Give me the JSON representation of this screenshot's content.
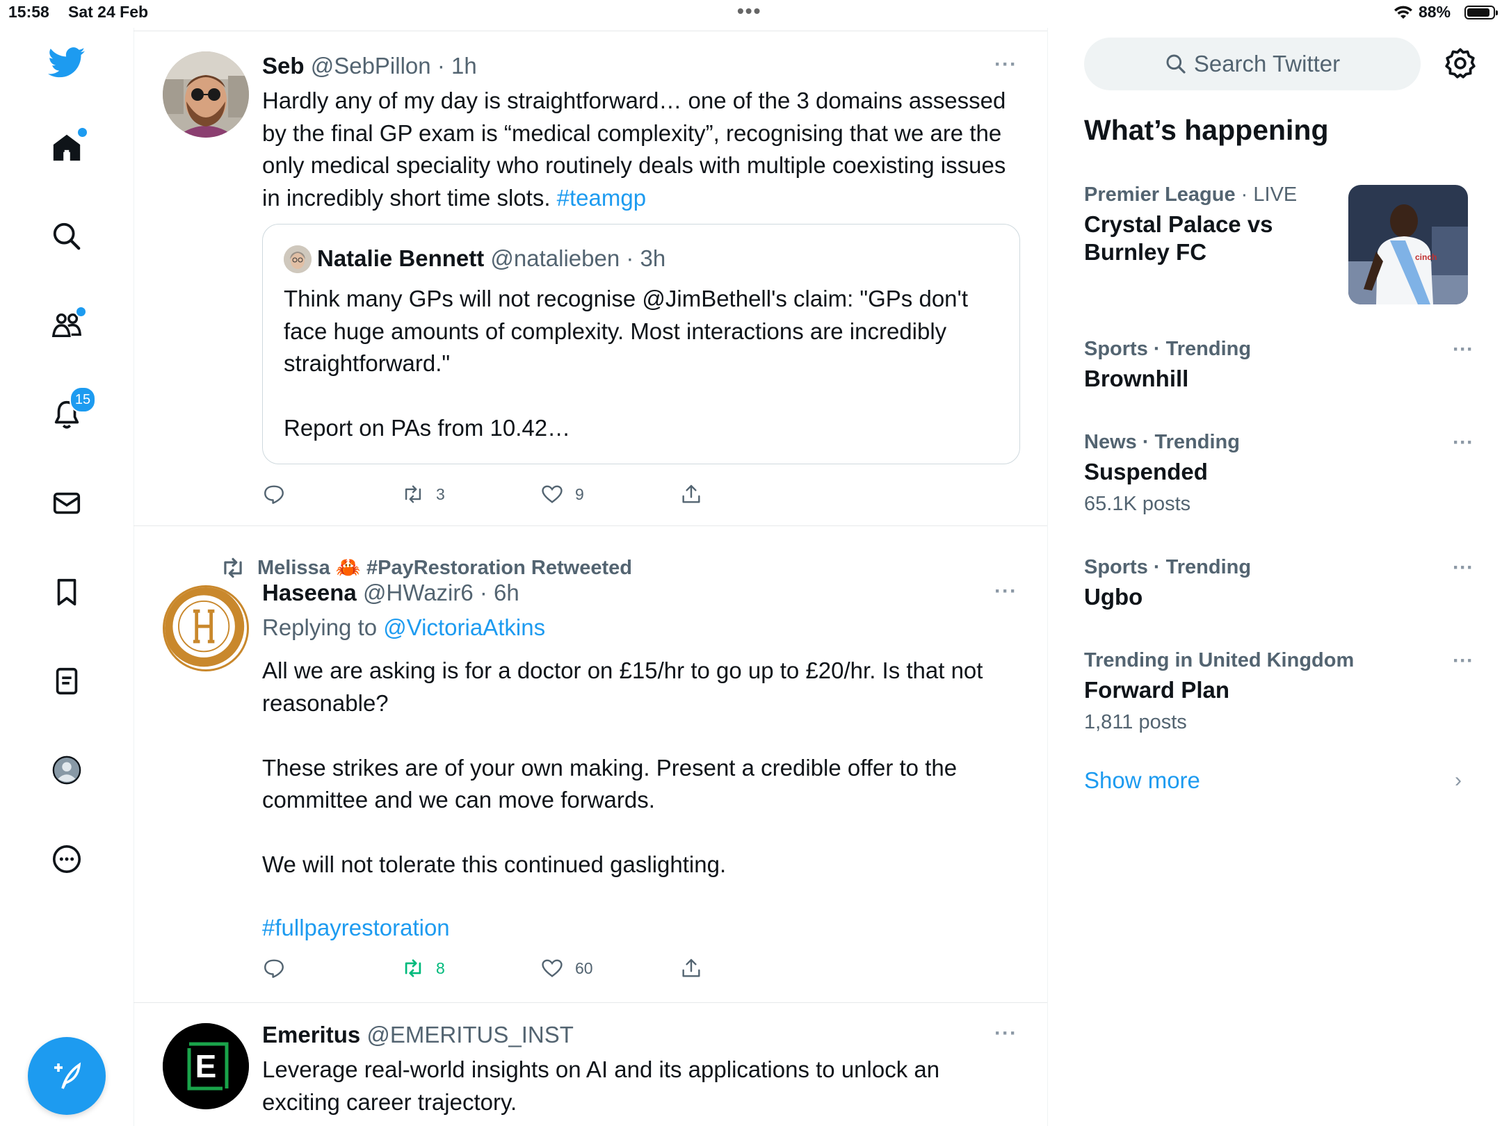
{
  "status_bar": {
    "time": "15:58",
    "date": "Sat 24 Feb",
    "battery": "88%",
    "battery_level": 0.88
  },
  "nav": {
    "logo_icon": "twitter-bird-icon",
    "items": [
      {
        "icon": "home-icon",
        "has_dot": true
      },
      {
        "icon": "search-icon"
      },
      {
        "icon": "communities-icon",
        "has_dot": true
      },
      {
        "icon": "bell-icon",
        "badge": "15"
      },
      {
        "icon": "mail-icon"
      },
      {
        "icon": "bookmark-icon"
      },
      {
        "icon": "lists-icon"
      },
      {
        "icon": "profile-icon"
      },
      {
        "icon": "more-icon"
      }
    ],
    "compose_icon": "compose-feather-icon"
  },
  "tweets": [
    {
      "name": "Seb",
      "handle": "@SebPillon",
      "time": "· 1h",
      "text": "Hardly any of my day is straightforward… one of the 3 domains assessed by the final GP exam is “medical complexity”, recognising that we are the only medical speciality who routinely deals with multiple coexisting issues in incredibly short time slots.",
      "hashtag": "#teamgp",
      "quote": {
        "name": "Natalie Bennett",
        "handle": "@natalieben",
        "time": "· 3h",
        "text": "Think many GPs will not recognise @JimBethell's claim: \"GPs don't face huge amounts of complexity. Most interactions are incredibly straightforward.\"\n\nReport on PAs from 10.42…"
      },
      "retweets": "3",
      "likes": "9"
    },
    {
      "retweeted_by": "Melissa 🦀 #PayRestoration Retweeted",
      "name": "Haseena",
      "handle": "@HWazir6",
      "time": "· 6h",
      "replying_prefix": "Replying to ",
      "replying_to": "@VictoriaAtkins",
      "text": "All we are asking is for a doctor on £15/hr to go up to £20/hr. Is that not reasonable?\n\nThese strikes are of your own making. Present a credible offer to the committee and we can move forwards.\n\nWe will not tolerate this continued gaslighting.",
      "hashtag": "#fullpayrestoration",
      "retweets": "8",
      "likes": "60"
    },
    {
      "name": "Emeritus",
      "handle": "@EMERITUS_INST",
      "text": "Leverage real-world insights on AI and its applications to unlock an exciting career trajectory."
    }
  ],
  "right": {
    "search_placeholder": "Search Twitter",
    "trends_title": "What’s happening",
    "trends": [
      {
        "meta": "Premier League",
        "live": "· LIVE",
        "title": "Crystal Palace vs Burnley FC"
      },
      {
        "meta": "Sports · Trending",
        "title": "Brownhill"
      },
      {
        "meta": "News · Trending",
        "title": "Suspended",
        "count": "65.1K posts"
      },
      {
        "meta": "Sports · Trending",
        "title": "Ugbo"
      },
      {
        "meta": "Trending in United Kingdom",
        "title": "Forward Plan",
        "count": "1,811 posts"
      }
    ],
    "show_more": "Show more"
  },
  "colors": {
    "accent": "#1d9bf0",
    "retweet_green": "#00ba7c",
    "text_secondary": "#536471"
  }
}
